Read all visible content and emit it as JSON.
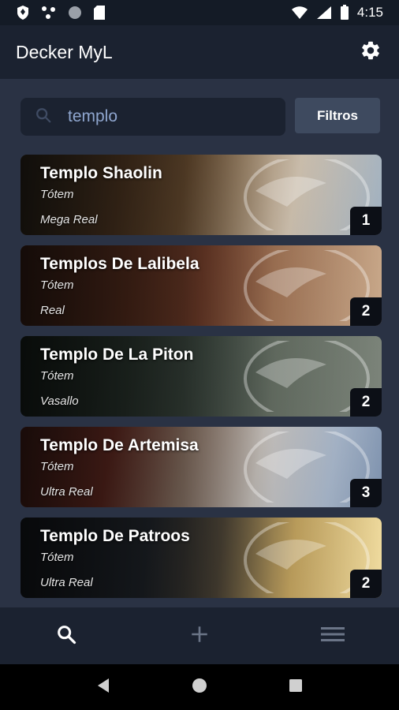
{
  "status_bar": {
    "time": "4:15",
    "left_icons": [
      "shield-icon",
      "dots-icon",
      "circle-icon",
      "sd-card-icon"
    ],
    "right_icons": [
      "wifi-icon",
      "signal-icon",
      "battery-icon"
    ]
  },
  "app_bar": {
    "title": "Decker MyL",
    "settings_icon": "gear-icon"
  },
  "search": {
    "value": "templo",
    "icon": "search-icon",
    "filter_label": "Filtros"
  },
  "cards": [
    {
      "name": "Templo Shaolin",
      "type": "Tótem",
      "rarity": "Mega Real",
      "count": "1"
    },
    {
      "name": "Templos De Lalibela",
      "type": "Tótem",
      "rarity": "Real",
      "count": "2"
    },
    {
      "name": "Templo De La Piton",
      "type": "Tótem",
      "rarity": "Vasallo",
      "count": "2"
    },
    {
      "name": "Templo De Artemisa",
      "type": "Tótem",
      "rarity": "Ultra Real",
      "count": "3"
    },
    {
      "name": "Templo De Patroos",
      "type": "Tótem",
      "rarity": "Ultra Real",
      "count": "2"
    }
  ],
  "bottom_nav": {
    "items": [
      "search-icon",
      "add-icon",
      "menu-icon"
    ],
    "active": "search-icon"
  },
  "system_nav": [
    "back-icon",
    "home-icon",
    "recents-icon"
  ],
  "colors": {
    "background": "#2a3244",
    "app_bar": "#1b2230",
    "status_bar": "#141b26",
    "filter_button": "#3e4a5f",
    "search_text": "#8fa6cf"
  }
}
